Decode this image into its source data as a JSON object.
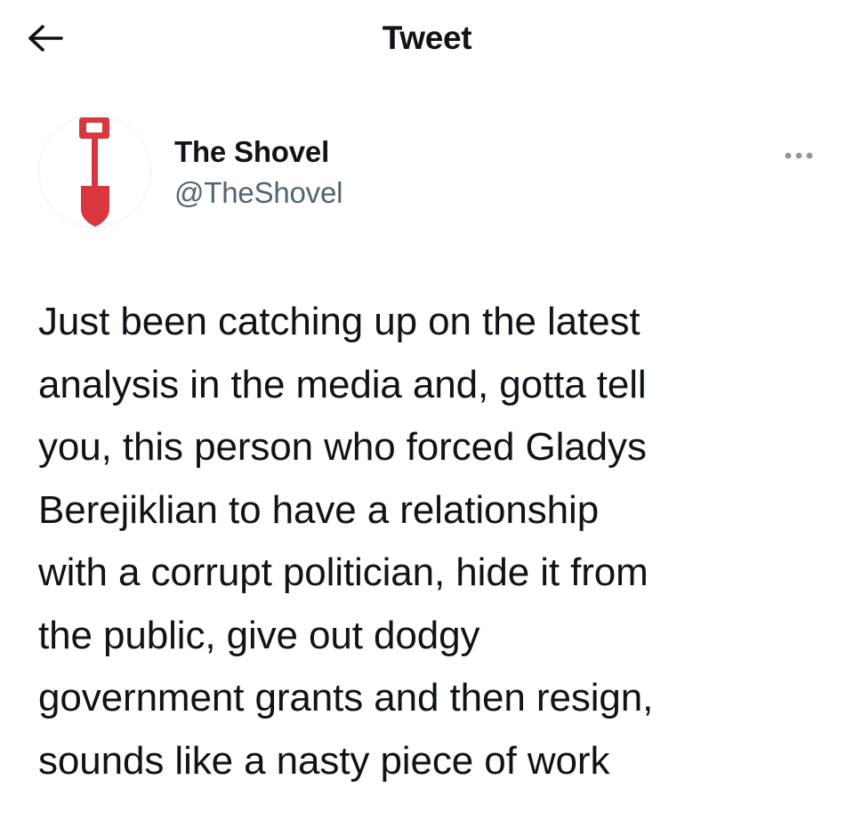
{
  "header": {
    "title": "Tweet",
    "back_icon": "arrow-left-icon"
  },
  "author": {
    "name": "The Shovel",
    "handle": "@TheShovel",
    "avatar_icon": "shovel-icon",
    "more_icon": "more-horizontal-icon"
  },
  "tweet": {
    "lines": [
      "Just been catching up on the latest",
      "analysis in the media and, gotta tell",
      "you, this person who forced Gladys",
      "Berejiklian to have a relationship",
      "with a corrupt politician, hide it from",
      "the public, give out dodgy",
      "government grants and then resign,",
      "sounds like a nasty piece of work"
    ]
  },
  "colors": {
    "text": "#0f1419",
    "secondary": "#536471",
    "brand_red": "#d9363e",
    "background": "#ffffff"
  }
}
